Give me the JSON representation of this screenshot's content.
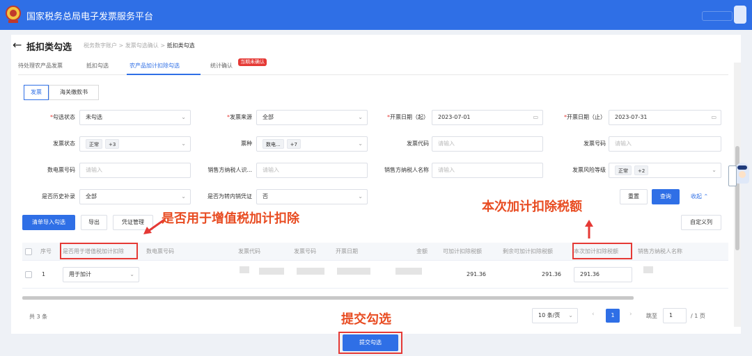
{
  "header": {
    "app_title": "国家税务总局电子发票服务平台"
  },
  "page": {
    "title": "抵扣类勾选",
    "breadcrumb": [
      "税务数字账户",
      "发票勾选确认",
      "抵扣类勾选"
    ],
    "breadcrumb_sep": ">"
  },
  "tabs": [
    {
      "label": "待处理农产品发票"
    },
    {
      "label": "抵扣勾选"
    },
    {
      "label": "农产品加计扣除勾选",
      "active": true
    },
    {
      "label": "统计确认"
    }
  ],
  "tab_badge": "当期未确认",
  "subtabs": [
    {
      "label": "发票",
      "active": true
    },
    {
      "label": "海关缴款书"
    }
  ],
  "form": {
    "r1": [
      {
        "label": "勾选状态",
        "required": true,
        "value": "未勾选"
      },
      {
        "label": "发票来源",
        "required": true,
        "value": "全部"
      },
      {
        "label": "开票日期（起）",
        "required": true,
        "value": "2023-07-01"
      },
      {
        "label": "开票日期（止）",
        "required": true,
        "value": "2023-07-31"
      }
    ],
    "r2": [
      {
        "label": "发票状态",
        "tag": "正常",
        "more": "+3"
      },
      {
        "label": "票种",
        "tag": "数电...",
        "more": "+7"
      },
      {
        "label": "发票代码",
        "placeholder": "请输入"
      },
      {
        "label": "发票号码",
        "placeholder": "请输入"
      }
    ],
    "r3": [
      {
        "label": "数电票号码",
        "placeholder": "请输入"
      },
      {
        "label": "销售方纳税人识...",
        "placeholder": "请输入"
      },
      {
        "label": "销售方纳税人名称",
        "placeholder": "请输入"
      },
      {
        "label": "发票风险等级",
        "tag": "正常",
        "more": "+2"
      }
    ],
    "r4": [
      {
        "label": "是否历史补录",
        "value": "全部"
      },
      {
        "label": "是否为转内销凭证",
        "value": "否"
      }
    ],
    "reset_label": "重置",
    "query_label": "查询",
    "collapse_label": "收起"
  },
  "toolbar": {
    "import_label": "清单导入勾选",
    "export_label": "导出",
    "voucher_label": "凭证管理",
    "custom_cols_label": "自定义列"
  },
  "table": {
    "columns": [
      "序号",
      "是否用于增值税加计扣除",
      "数电票号码",
      "发票代码",
      "发票号码",
      "开票日期",
      "金额",
      "可加计扣除税额",
      "剩余可加计扣除税额",
      "本次加计扣除税额",
      "销售方纳税人名称"
    ],
    "rows": [
      {
        "index": "1",
        "use": "用于加计",
        "deductible": "291.36",
        "remaining": "291.36",
        "current": "291.36"
      }
    ]
  },
  "pagination": {
    "total": "共 3 条",
    "page_size": "10 条/页",
    "current": "1",
    "jump_label": "跳至",
    "jump_value": "1",
    "total_pages": "/ 1 页"
  },
  "submit_label": "提交勾选",
  "annotations": {
    "vat_label": "是否用于增值税加计扣除",
    "amount_label": "本次加计扣除税额",
    "submit_label": "提交勾选"
  },
  "colors": {
    "primary": "#2f6fe6",
    "annotation": "#e53935"
  }
}
